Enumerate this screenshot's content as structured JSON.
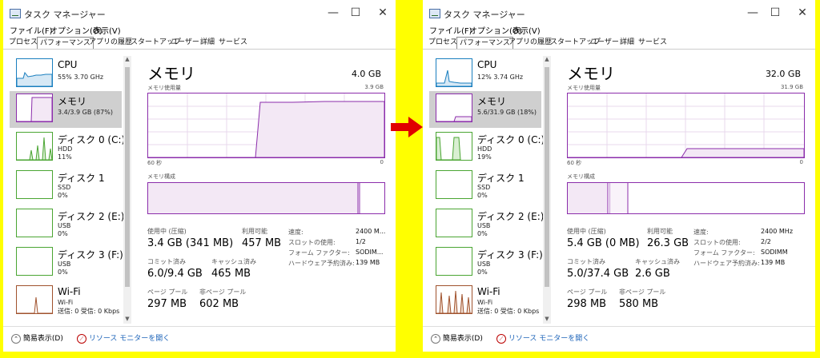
{
  "colors": {
    "background": "#ffff00",
    "cpu": "#1a7fbf",
    "memory": "#8b2dab",
    "disk": "#4aa532",
    "wifi": "#a0522d",
    "arrow": "#e00000"
  },
  "window": {
    "title": "タスク マネージャー",
    "controls": {
      "minimize": "—",
      "maximize": "☐",
      "close": "✕"
    }
  },
  "menu": [
    "ファイル(F)",
    "オプション(O)",
    "表示(V)"
  ],
  "tabs": [
    "プロセス",
    "パフォーマンス",
    "アプリの履歴",
    "スタートアップ",
    "ユーザー",
    "詳細",
    "サービス"
  ],
  "footer": {
    "fewer_details": "簡易表示(D)",
    "resource_monitor": "リソース モニターを開く"
  },
  "left": {
    "sidebar": [
      {
        "name": "CPU",
        "line1": "55%  3.70 GHz"
      },
      {
        "name": "メモリ",
        "line1": "3.4/3.9 GB (87%)"
      },
      {
        "name": "ディスク 0 (C:)",
        "line1": "HDD",
        "line2": "11%"
      },
      {
        "name": "ディスク 1",
        "line1": "SSD",
        "line2": "0%"
      },
      {
        "name": "ディスク 2 (E:)",
        "line1": "USB",
        "line2": "0%"
      },
      {
        "name": "ディスク 3 (F:)",
        "line1": "USB",
        "line2": "0%"
      },
      {
        "name": "Wi-Fi",
        "line1": "Wi-Fi",
        "line2": "送信: 0 受信: 0 Kbps"
      }
    ],
    "main": {
      "title": "メモリ",
      "capacity": "4.0 GB",
      "usage_label": "メモリ使用量",
      "usage_max": "3.9 GB",
      "axis_left": "60 秒",
      "axis_right": "0",
      "composition_label": "メモリ構成",
      "in_use_label": "使用中 (圧縮)",
      "in_use": "3.4 GB (341 MB)",
      "available_label": "利用可能",
      "available": "457 MB",
      "committed_label": "コミット済み",
      "committed": "6.0/9.4 GB",
      "cached_label": "キャッシュ済み",
      "cached": "465 MB",
      "paged_label": "ページ プール",
      "paged": "297 MB",
      "nonpaged_label": "非ページ プール",
      "nonpaged": "602 MB",
      "speed_label": "速度:",
      "speed": "2400 M...",
      "slots_label": "スロットの使用:",
      "slots": "1/2",
      "form_label": "フォーム ファクター:",
      "form": "SODIM...",
      "reserved_label": "ハードウェア予約済み:",
      "reserved": "139 MB"
    }
  },
  "right": {
    "sidebar": [
      {
        "name": "CPU",
        "line1": "12%  3.74 GHz"
      },
      {
        "name": "メモリ",
        "line1": "5.6/31.9 GB (18%)"
      },
      {
        "name": "ディスク 0 (C:)",
        "line1": "HDD",
        "line2": "19%"
      },
      {
        "name": "ディスク 1",
        "line1": "SSD",
        "line2": "0%"
      },
      {
        "name": "ディスク 2 (E:)",
        "line1": "USB",
        "line2": "0%"
      },
      {
        "name": "ディスク 3 (F:)",
        "line1": "USB",
        "line2": "0%"
      },
      {
        "name": "Wi-Fi",
        "line1": "Wi-Fi",
        "line2": "送信: 0 受信: 0 Kbps"
      }
    ],
    "main": {
      "title": "メモリ",
      "capacity": "32.0 GB",
      "usage_label": "メモリ使用量",
      "usage_max": "31.9 GB",
      "axis_left": "60 秒",
      "axis_right": "0",
      "composition_label": "メモリ構成",
      "in_use_label": "使用中 (圧縮)",
      "in_use": "5.4 GB (0 MB)",
      "available_label": "利用可能",
      "available": "26.3 GB",
      "committed_label": "コミット済み",
      "committed": "5.0/37.4 GB",
      "cached_label": "キャッシュ済み",
      "cached": "2.6 GB",
      "paged_label": "ページ プール",
      "paged": "298 MB",
      "nonpaged_label": "非ページ プール",
      "nonpaged": "580 MB",
      "speed_label": "速度:",
      "speed": "2400 MHz",
      "slots_label": "スロットの使用:",
      "slots": "2/2",
      "form_label": "フォーム ファクター:",
      "form": "SODIMM",
      "reserved_label": "ハードウェア予約済み:",
      "reserved": "139 MB"
    }
  }
}
